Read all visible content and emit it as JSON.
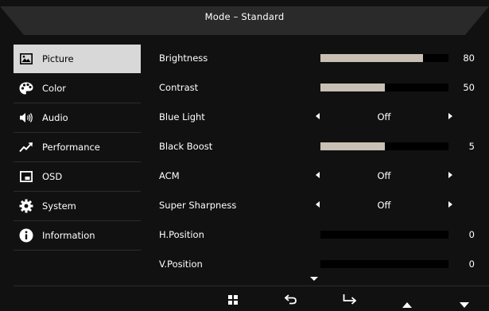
{
  "header": {
    "title": "Mode – Standard"
  },
  "sidebar": {
    "items": [
      {
        "label": "Picture",
        "icon": "picture-icon",
        "active": true
      },
      {
        "label": "Color",
        "icon": "palette-icon",
        "active": false
      },
      {
        "label": "Audio",
        "icon": "speaker-icon",
        "active": false
      },
      {
        "label": "Performance",
        "icon": "performance-icon",
        "active": false
      },
      {
        "label": "OSD",
        "icon": "osd-icon",
        "active": false
      },
      {
        "label": "System",
        "icon": "gear-icon",
        "active": false
      },
      {
        "label": "Information",
        "icon": "info-icon",
        "active": false
      }
    ]
  },
  "settings": [
    {
      "label": "Brightness",
      "type": "slider",
      "value": "80",
      "level": 80
    },
    {
      "label": "Contrast",
      "type": "slider",
      "value": "50",
      "level": 50
    },
    {
      "label": "Blue Light",
      "type": "option",
      "value": "Off"
    },
    {
      "label": "Black Boost",
      "type": "slider",
      "value": "5",
      "level": 50
    },
    {
      "label": "ACM",
      "type": "option",
      "value": "Off"
    },
    {
      "label": "Super Sharpness",
      "type": "option",
      "value": "Off"
    },
    {
      "label": "H.Position",
      "type": "slider",
      "value": "0",
      "level": 0
    },
    {
      "label": "V.Position",
      "type": "slider",
      "value": "0",
      "level": 0
    }
  ],
  "footer": {
    "icons": [
      "menu-grid-icon",
      "back-icon",
      "enter-icon",
      "up-arrow-icon",
      "down-arrow-icon"
    ]
  },
  "colors": {
    "background": "#111111",
    "active_item": "#d8d8d8",
    "slider_fill": "#c8c0b4",
    "slider_track": "#000000"
  }
}
